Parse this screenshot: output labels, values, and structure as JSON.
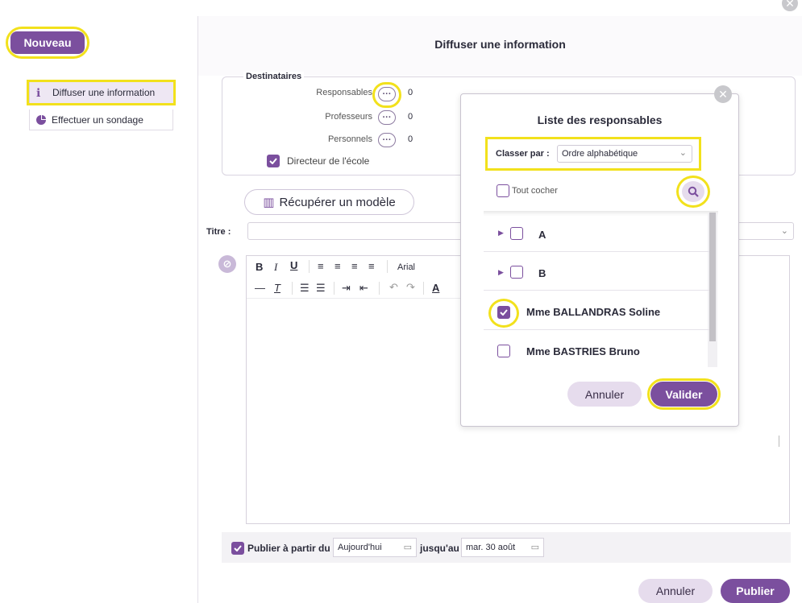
{
  "left": {
    "new_button": "Nouveau",
    "menu": [
      {
        "label": "Diffuser une information",
        "icon": "info-icon"
      },
      {
        "label": "Effectuer un sondage",
        "icon": "pie-chart-icon"
      }
    ]
  },
  "form": {
    "title": "Diffuser une information",
    "recipients_legend": "Destinataires",
    "recipients": [
      {
        "label": "Responsables",
        "count": "0"
      },
      {
        "label": "Professeurs",
        "count": "0"
      },
      {
        "label": "Personnels",
        "count": "0"
      }
    ],
    "director_label": "Directeur de l'école",
    "template_button": "Récupérer un modèle",
    "titre_label": "Titre :",
    "font_name": "Arial",
    "publish_from_label": "Publier à partir du",
    "publish_from_value": "Aujourd'hui",
    "publish_until_label": "jusqu'au",
    "publish_until_value": "mar. 30 août",
    "cancel_button": "Annuler",
    "publish_button": "Publier"
  },
  "modal": {
    "title": "Liste des responsables",
    "sort_label": "Classer par :",
    "sort_value": "Ordre alphabétique",
    "check_all_label": "Tout cocher",
    "rows": [
      {
        "label": "A",
        "group": true,
        "checked": false
      },
      {
        "label": "B",
        "group": true,
        "checked": false
      },
      {
        "label": "Mme BALLANDRAS Soline",
        "group": false,
        "checked": true
      },
      {
        "label": "Mme BASTRIES Bruno",
        "group": false,
        "checked": false
      }
    ],
    "cancel_button": "Annuler",
    "validate_button": "Valider"
  },
  "colors": {
    "accent": "#7b4f9e",
    "highlight": "#f2e11c",
    "lavender": "#e6dced"
  }
}
